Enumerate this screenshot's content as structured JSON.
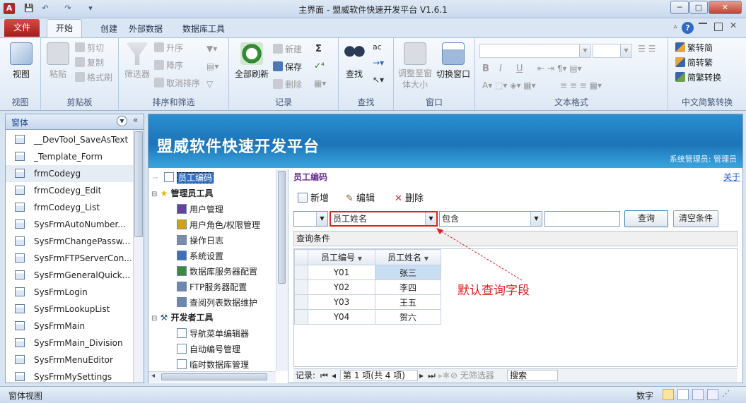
{
  "window": {
    "title": "主界面 - 盟威软件快速开发平台 V1.6.1",
    "min": "─",
    "max": "□",
    "close": "✕"
  },
  "tabs": {
    "file": "文件",
    "home": "开始",
    "create": "创建",
    "external": "外部数据",
    "dbtools": "数据库工具"
  },
  "ribbon": {
    "view": {
      "btn": "视图",
      "group": "视图"
    },
    "clipboard": {
      "paste": "粘贴",
      "cut": "剪切",
      "copy": "复制",
      "format_painter": "格式刷",
      "group": "剪贴板"
    },
    "sort": {
      "filter": "筛选器",
      "asc": "升序",
      "desc": "降序",
      "remove": "取消排序",
      "group": "排序和筛选"
    },
    "records": {
      "refresh": "全部刷新",
      "new": "新建",
      "save": "保存",
      "delete": "删除",
      "sum": "Σ",
      "group": "记录"
    },
    "find": {
      "find": "查找",
      "group": "查找"
    },
    "window": {
      "resize": "调整至窗体大小",
      "switch": "切换窗口",
      "group": "窗口"
    },
    "text": {
      "bold": "B",
      "italic": "I",
      "underline": "U",
      "group": "文本格式"
    },
    "chinese": {
      "t2s": "繁转简",
      "s2t": "简转繁",
      "conv": "简繁转换",
      "group": "中文简繁转换"
    }
  },
  "nav": {
    "header": "窗体",
    "items": [
      "__DevTool_SaveAsText",
      "_Template_Form",
      "frmCodeyg",
      "frmCodeyg_Edit",
      "frmCodeyg_List",
      "SysFrmAutoNumber...",
      "SysFrmChangePassw...",
      "SysFrmFTPServerCon...",
      "SysFrmGeneralQuick...",
      "SysFrmLogin",
      "SysFrmLookupList",
      "SysFrmMain",
      "SysFrmMain_Division",
      "SysFrmMenuEditor",
      "SysFrmMySettings"
    ]
  },
  "banner": {
    "title": "盟威软件快速开发平台",
    "user": "系统管理员: 管理员"
  },
  "tree": {
    "employee_code": "员工编码",
    "admin_tools": "管理员工具",
    "admin_items": [
      "用户管理",
      "用户角色/权限管理",
      "操作日志",
      "系统设置",
      "数据库服务器配置",
      "FTP服务器配置",
      "查阅列表数据维护"
    ],
    "dev_tools": "开发者工具",
    "dev_items": [
      "导航菜单编辑器",
      "自动编号管理",
      "临时数据库管理"
    ]
  },
  "form": {
    "title": "员工编码",
    "close_link": "关于",
    "toolbar": {
      "add": "新增",
      "edit": "编辑",
      "delete": "删除"
    },
    "filter": {
      "field": "员工姓名",
      "op": "包含",
      "value": "",
      "query": "查询",
      "clear": "清空条件"
    },
    "query_label": "查询条件",
    "columns": [
      "员工编号",
      "员工姓名"
    ],
    "rows": [
      [
        "Y01",
        "张三"
      ],
      [
        "Y02",
        "李四"
      ],
      [
        "Y03",
        "王五"
      ],
      [
        "Y04",
        "贺六"
      ]
    ],
    "annotation": "默认查询字段",
    "recnav": {
      "label": "记录:",
      "position": "第 1 项(共 4 项)",
      "nofilter": "无筛选器",
      "search": "搜索"
    }
  },
  "status": {
    "left": "窗体视图",
    "right": "数字"
  }
}
